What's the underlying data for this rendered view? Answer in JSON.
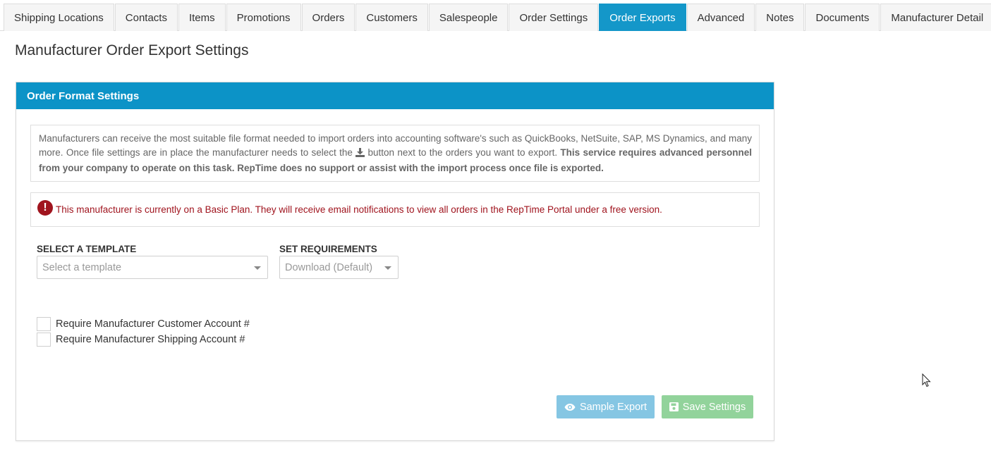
{
  "tabs": [
    {
      "label": "Shipping Locations",
      "active": false
    },
    {
      "label": "Contacts",
      "active": false
    },
    {
      "label": "Items",
      "active": false
    },
    {
      "label": "Promotions",
      "active": false
    },
    {
      "label": "Orders",
      "active": false
    },
    {
      "label": "Customers",
      "active": false
    },
    {
      "label": "Salespeople",
      "active": false
    },
    {
      "label": "Order Settings",
      "active": false
    },
    {
      "label": "Order Exports",
      "active": true
    },
    {
      "label": "Advanced",
      "active": false
    },
    {
      "label": "Notes",
      "active": false
    },
    {
      "label": "Documents",
      "active": false
    },
    {
      "label": "Manufacturer Detail",
      "active": false
    }
  ],
  "page": {
    "title": "Manufacturer Order Export Settings"
  },
  "panel": {
    "header": "Order Format Settings",
    "info": {
      "text_part1": "Manufacturers can receive the most suitable file format needed to import orders into accounting software's such as QuickBooks, NetSuite, SAP, MS Dynamics, and many more. Once file settings are in place the manufacturer needs to select the ",
      "icon": "download-icon",
      "text_part2": " button next to the orders you want to export. ",
      "bold_text": "This service requires advanced personnel from your company to operate on this task. RepTime does no support or assist with the import process once file is exported."
    },
    "alert": {
      "icon": "exclamation-circle-icon",
      "text": "This manufacturer is currently on a Basic Plan. They will receive email notifications to view all orders in the RepTime Portal under a free version."
    },
    "template": {
      "label": "SELECT A TEMPLATE",
      "placeholder": "Select a template"
    },
    "requirements": {
      "label": "SET REQUIREMENTS",
      "value": "Download (Default)"
    },
    "checkboxes": [
      {
        "label": "Require Manufacturer Customer Account #",
        "checked": false
      },
      {
        "label": "Require Manufacturer Shipping Account #",
        "checked": false
      }
    ],
    "buttons": {
      "sample_export": "Sample Export",
      "save_settings": "Save Settings"
    }
  },
  "colors": {
    "active_tab": "#1497c9",
    "panel_header": "#0c93c7",
    "alert_text": "#a0141e",
    "sample_button": "#85c6e3",
    "save_button": "#92d39b"
  }
}
